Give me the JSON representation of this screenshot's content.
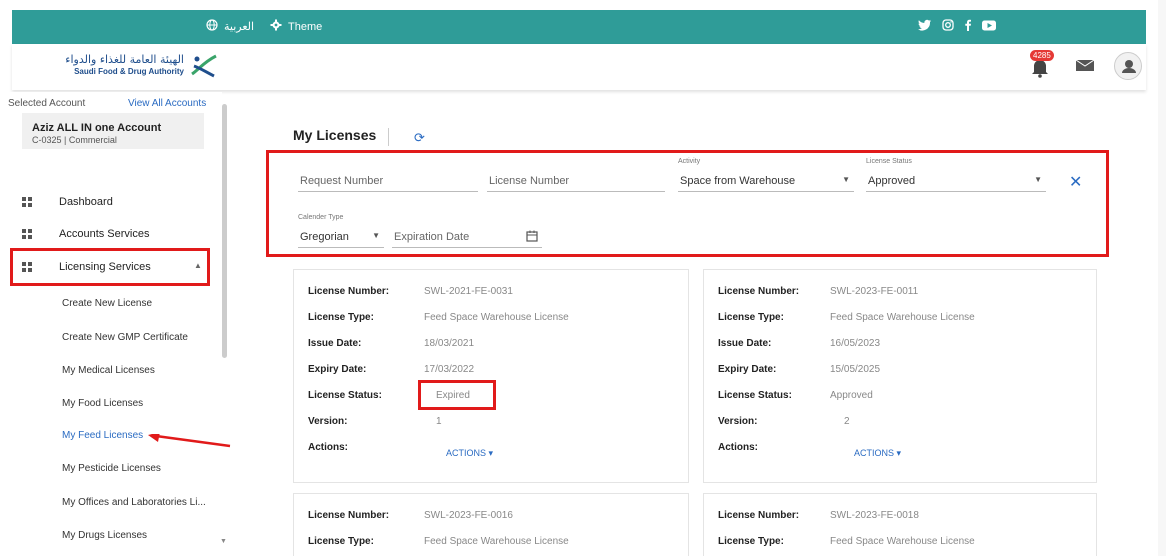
{
  "topbar": {
    "lang": "العربية",
    "theme": "Theme",
    "social": [
      "twitter-icon",
      "instagram-icon",
      "facebook-icon",
      "youtube-icon"
    ]
  },
  "header": {
    "logo_ar": "الهيئة العامة للغذاء والدواء",
    "logo_en": "Saudi Food & Drug Authority",
    "notifications": "4285"
  },
  "sidebar": {
    "selected_account_label": "Selected Account",
    "view_all": "View All Accounts",
    "account_name": "Aziz ALL IN one Account",
    "account_sub": "C-0325  |  Commercial",
    "items": [
      {
        "label": "Dashboard"
      },
      {
        "label": "Accounts Services"
      },
      {
        "label": "Licensing Services"
      }
    ],
    "subitems": [
      {
        "label": "Create New License"
      },
      {
        "label": "Create New GMP Certificate"
      },
      {
        "label": "My Medical Licenses"
      },
      {
        "label": "My Food Licenses"
      },
      {
        "label": "My Feed Licenses"
      },
      {
        "label": "My Pesticide Licenses"
      },
      {
        "label": "My Offices and Laboratories Li..."
      },
      {
        "label": "My Drugs Licenses"
      }
    ]
  },
  "main": {
    "title": "My Licenses",
    "filters": {
      "request_number": "Request Number",
      "license_number": "License Number",
      "activity_label": "Activity",
      "activity_value": "Space from Warehouse",
      "status_label": "License Status",
      "status_value": "Approved",
      "calendar_label": "Calender Type",
      "calendar_value": "Gregorian",
      "expiration": "Expiration Date"
    },
    "field_labels": {
      "license_number": "License Number:",
      "license_type": "License Type:",
      "issue_date": "Issue Date:",
      "expiry_date": "Expiry Date:",
      "license_status": "License Status:",
      "version": "Version:",
      "actions": "Actions:",
      "actions_button": "ACTIONS"
    },
    "cards": [
      {
        "license_number": "SWL-2021-FE-0031",
        "license_type": "Feed Space Warehouse License",
        "issue_date": "18/03/2021",
        "expiry_date": "17/03/2022",
        "status": "Expired",
        "version": "1"
      },
      {
        "license_number": "SWL-2023-FE-0011",
        "license_type": "Feed Space Warehouse License",
        "issue_date": "16/05/2023",
        "expiry_date": "15/05/2025",
        "status": "Approved",
        "version": "2"
      },
      {
        "license_number": "SWL-2023-FE-0016",
        "license_type": "Feed Space Warehouse License"
      },
      {
        "license_number": "SWL-2023-FE-0018",
        "license_type": "Feed Space Warehouse License"
      }
    ]
  },
  "colors": {
    "teal": "#2f9c98",
    "accent": "#2a6bc2",
    "highlight": "#e11a1a"
  }
}
